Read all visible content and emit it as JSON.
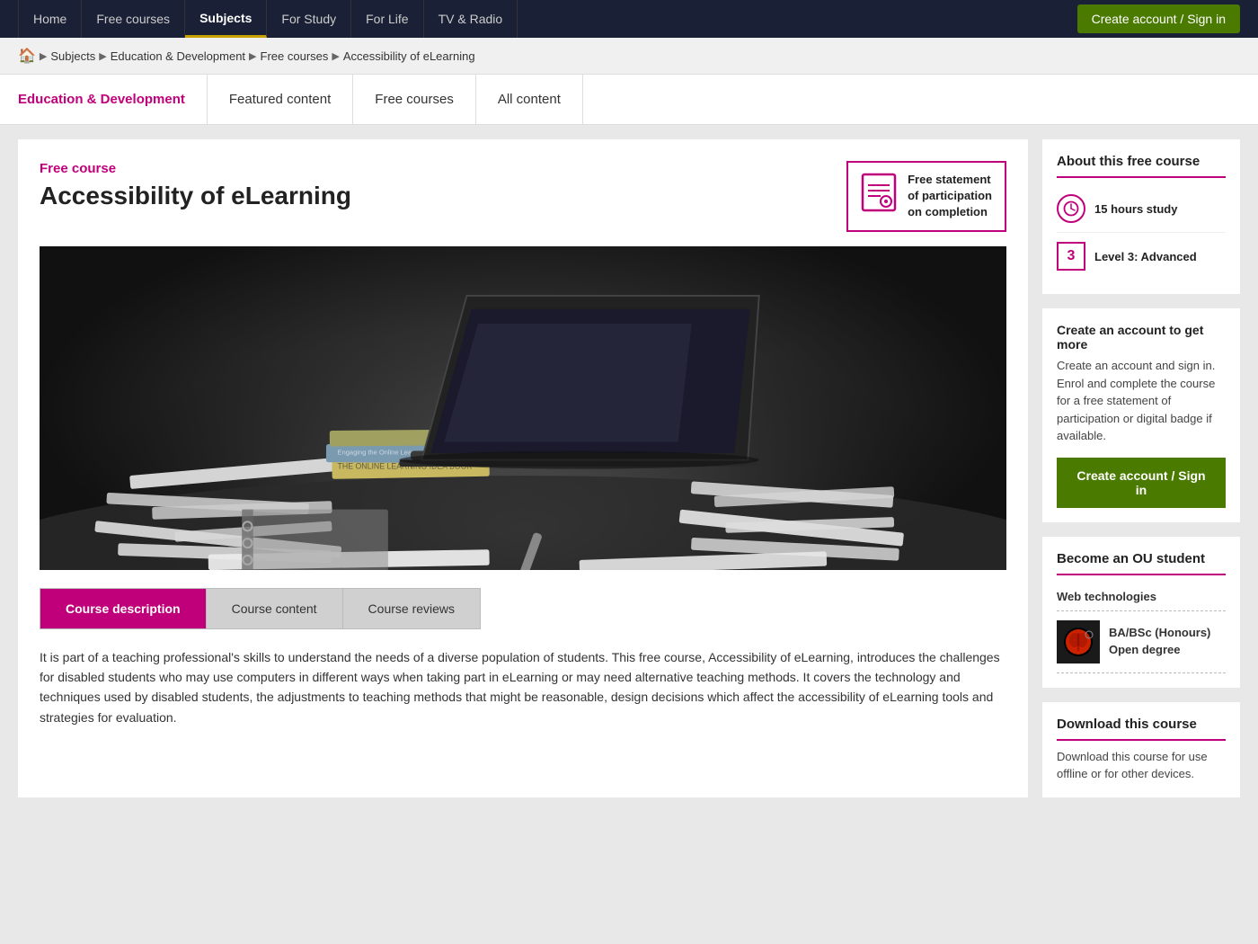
{
  "topnav": {
    "links": [
      {
        "label": "Home",
        "active": false
      },
      {
        "label": "Free courses",
        "active": false
      },
      {
        "label": "Subjects",
        "active": true
      },
      {
        "label": "For Study",
        "active": false
      },
      {
        "label": "For Life",
        "active": false
      },
      {
        "label": "TV & Radio",
        "active": false
      }
    ],
    "cta_label": "Create account / Sign in"
  },
  "breadcrumb": {
    "home_icon": "🏠",
    "items": [
      "Subjects",
      "Education & Development",
      "Free courses",
      "Accessibility of eLearning"
    ]
  },
  "section_tabs": {
    "items": [
      {
        "label": "Education & Development",
        "active": true
      },
      {
        "label": "Featured content",
        "active": false
      },
      {
        "label": "Free courses",
        "active": false
      },
      {
        "label": "All content",
        "active": false
      }
    ]
  },
  "course": {
    "free_label": "Free course",
    "title": "Accessibility of eLearning",
    "participation_line1": "Free statement",
    "participation_line2": "of participation",
    "participation_line3": "on completion",
    "image_alt": "Laptop and books on desk"
  },
  "course_tabs": [
    {
      "label": "Course description",
      "active": true
    },
    {
      "label": "Course content",
      "active": false
    },
    {
      "label": "Course reviews",
      "active": false
    }
  ],
  "description_text": "It is part of a teaching professional's skills to understand the needs of a diverse population of students. This free course, Accessibility of eLearning, introduces the challenges for disabled students who may use computers in different ways when taking part in eLearning or may need alternative teaching methods. It covers the technology and techniques used by disabled students, the adjustments to teaching methods that might be reasonable, design decisions which affect the accessibility of eLearning tools and strategies for evaluation.",
  "sidebar": {
    "about_title": "About this free course",
    "hours_label": "15 hours study",
    "level_number": "3",
    "level_label": "Level 3: Advanced",
    "create_heading": "Create an account to get more",
    "create_desc": "Create an account and sign in. Enrol and complete the course for a free statement of participation or digital badge if available.",
    "create_btn": "Create account / Sign in",
    "ou_title": "Become an OU student",
    "web_tech_label": "Web technologies",
    "degree_label": "BA/BSc (Honours) Open degree",
    "download_title": "Download this course",
    "download_desc": "Download this course for use offline or for other devices."
  }
}
